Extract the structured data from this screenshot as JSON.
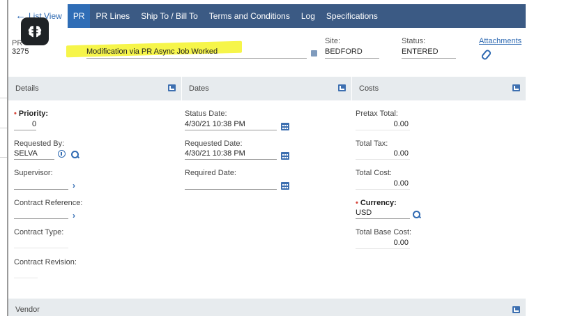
{
  "tabs": [
    {
      "label": "List View",
      "active": false
    },
    {
      "label": "PR",
      "active": true
    },
    {
      "label": "PR Lines",
      "active": false
    },
    {
      "label": "Ship To / Bill To",
      "active": false
    },
    {
      "label": "Terms and Conditions",
      "active": false
    },
    {
      "label": "Log",
      "active": false
    },
    {
      "label": "Specifications",
      "active": false
    }
  ],
  "header": {
    "pr_label": "PR",
    "pr_number": "3275",
    "description": "Modification via PR Async Job Worked",
    "site_label": "Site:",
    "site_value": "BEDFORD",
    "status_label": "Status:",
    "status_value": "ENTERED",
    "attachments_label": "Attachments"
  },
  "sections": {
    "details": "Details",
    "dates": "Dates",
    "costs": "Costs",
    "vendor": "Vendor"
  },
  "details": {
    "priority_label": "Priority:",
    "priority_value": "0",
    "requested_by_label": "Requested By:",
    "requested_by_value": "SELVA",
    "supervisor_label": "Supervisor:",
    "supervisor_value": "",
    "contract_reference_label": "Contract Reference:",
    "contract_reference_value": "",
    "contract_type_label": "Contract Type:",
    "contract_type_value": "",
    "contract_revision_label": "Contract Revision:",
    "contract_revision_value": ""
  },
  "dates": {
    "status_date_label": "Status Date:",
    "status_date_value": "4/30/21 10:38 PM",
    "requested_date_label": "Requested Date:",
    "requested_date_value": "4/30/21 10:38 PM",
    "required_date_label": "Required Date:",
    "required_date_value": ""
  },
  "costs": {
    "pretax_total_label": "Pretax Total:",
    "pretax_total_value": "0.00",
    "total_tax_label": "Total Tax:",
    "total_tax_value": "0.00",
    "total_cost_label": "Total Cost:",
    "total_cost_value": "0.00",
    "currency_label": "Currency:",
    "currency_value": "USD",
    "total_base_cost_label": "Total Base Cost:",
    "total_base_cost_value": "0.00"
  },
  "icons": {
    "back": "arrow-left-icon",
    "brain": "brain-icon",
    "calendar": "calendar-icon",
    "lookup": "magnifier-icon",
    "detail": "chevron-right-icon",
    "info": "info-icon",
    "attachment": "paperclip-icon",
    "section_toggle": "section-toggle-icon"
  },
  "colors": {
    "tabbar": "#3b5a84",
    "active_tab": "#2f6db6",
    "link": "#2f6ab2",
    "highlight": "#f6f54a",
    "section_band": "#e7ebee",
    "required_marker": "#d6463a"
  }
}
